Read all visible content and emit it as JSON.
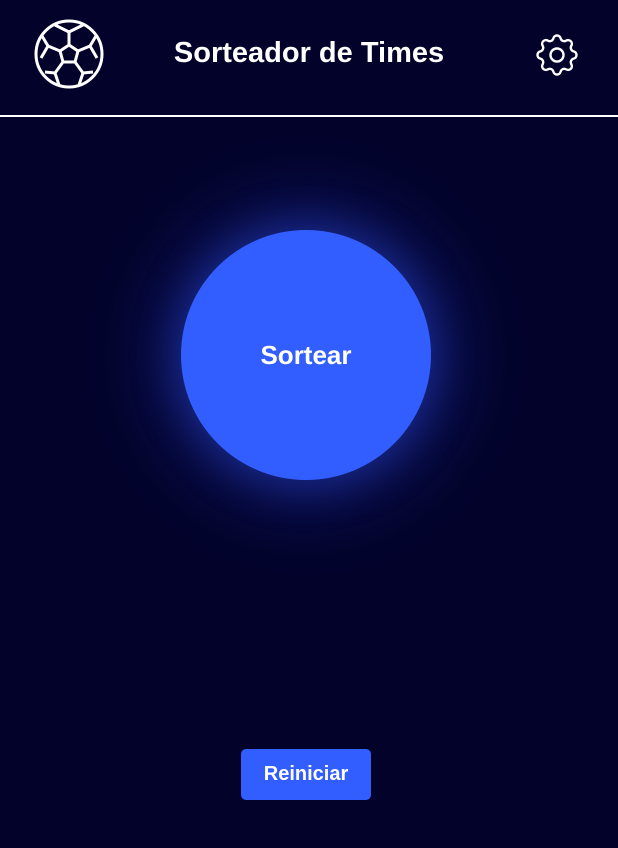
{
  "header": {
    "title": "Sorteador de Times",
    "logo_icon": "soccer-ball-icon",
    "settings_icon": "gear-icon"
  },
  "main": {
    "draw_label": "Sortear",
    "reset_label": "Reiniciar"
  },
  "colors": {
    "background": "#02022a",
    "accent": "#335eff",
    "text": "#ffffff"
  }
}
